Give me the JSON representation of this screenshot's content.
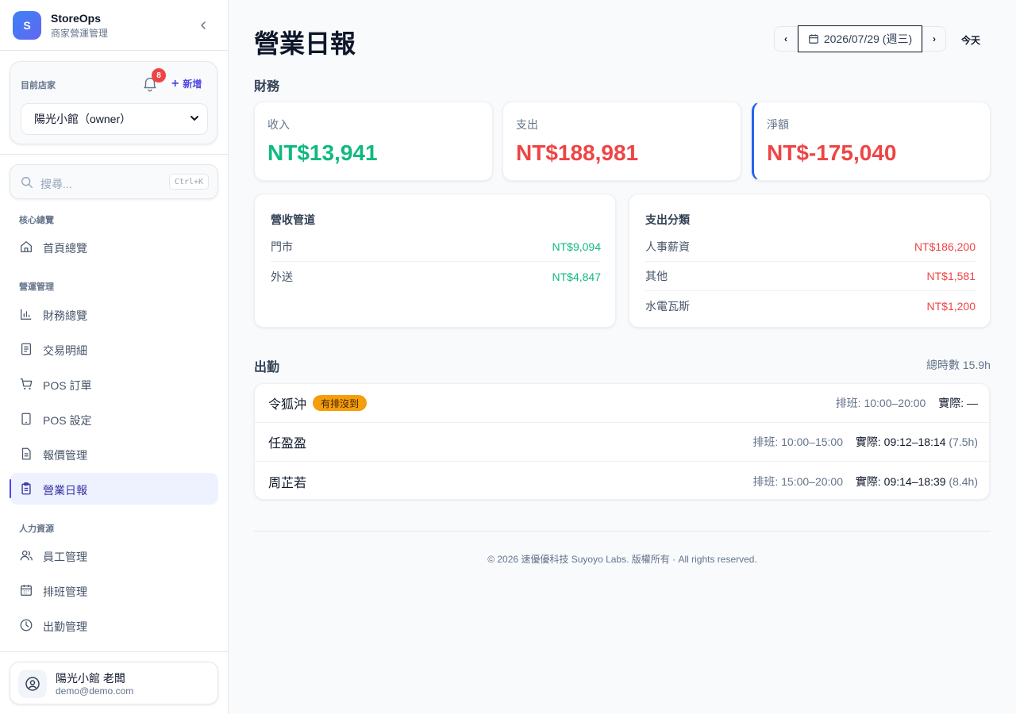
{
  "brand": {
    "logo_letter": "S",
    "name": "StoreOps",
    "subtitle": "商家營運管理"
  },
  "store": {
    "label": "目前店家",
    "notification_count": "8",
    "add_label": "新增",
    "selected_store": "陽光小館（owner）"
  },
  "search": {
    "placeholder": "搜尋...",
    "shortcut": "Ctrl+K"
  },
  "nav": {
    "groups": [
      {
        "label": "核心總覽"
      },
      {
        "label": "營運管理"
      },
      {
        "label": "人力資源"
      }
    ],
    "items": [
      {
        "label": "首頁總覽",
        "icon": "home-icon"
      },
      {
        "label": "財務總覽",
        "icon": "bar-chart-icon"
      },
      {
        "label": "交易明細",
        "icon": "receipt-icon"
      },
      {
        "label": "POS 訂單",
        "icon": "cart-icon"
      },
      {
        "label": "POS 設定",
        "icon": "tablet-icon"
      },
      {
        "label": "報價管理",
        "icon": "document-icon"
      },
      {
        "label": "營業日報",
        "icon": "clipboard-icon",
        "active": true
      },
      {
        "label": "員工管理",
        "icon": "users-icon"
      },
      {
        "label": "排班管理",
        "icon": "calendar-icon"
      },
      {
        "label": "出勤管理",
        "icon": "clock-icon"
      }
    ]
  },
  "user": {
    "name": "陽光小館 老闆",
    "email": "demo@demo.com"
  },
  "header": {
    "title": "營業日報",
    "prev": "‹",
    "date": "2026/07/29 (週三)",
    "next": "›",
    "today": "今天"
  },
  "finance": {
    "section_title": "財務",
    "income_label": "收入",
    "income_value": "NT$13,941",
    "expense_label": "支出",
    "expense_value": "NT$188,981",
    "net_label": "淨額",
    "net_value": "NT$-175,040"
  },
  "revenue_channels": {
    "title": "營收管道",
    "rows": [
      {
        "name": "門市",
        "amount": "NT$9,094"
      },
      {
        "name": "外送",
        "amount": "NT$4,847"
      }
    ]
  },
  "expense_categories": {
    "title": "支出分類",
    "rows": [
      {
        "name": "人事薪資",
        "amount": "NT$186,200"
      },
      {
        "name": "其他",
        "amount": "NT$1,581"
      },
      {
        "name": "水電瓦斯",
        "amount": "NT$1,200"
      }
    ]
  },
  "attendance": {
    "section_title": "出勤",
    "total": "總時數 15.9h",
    "rows": [
      {
        "name": "令狐沖",
        "badge": "有排沒到",
        "scheduled": "排班: 10:00–20:00",
        "actual_label": "實際:",
        "actual": "—",
        "hours": ""
      },
      {
        "name": "任盈盈",
        "badge": "",
        "scheduled": "排班: 10:00–15:00",
        "actual_label": "實際:",
        "actual": "09:12–18:14",
        "hours": "(7.5h)"
      },
      {
        "name": "周芷若",
        "badge": "",
        "scheduled": "排班: 15:00–20:00",
        "actual_label": "實際:",
        "actual": "09:14–18:39",
        "hours": "(8.4h)"
      }
    ]
  },
  "footer": {
    "text": "© 2026 速優優科技 Suyoyo Labs. 版權所有 · All rights reserved."
  },
  "colors": {
    "income": "#10b981",
    "expense": "#ef4444",
    "accent": "#4f46e5",
    "badge": "#f59e0b"
  }
}
